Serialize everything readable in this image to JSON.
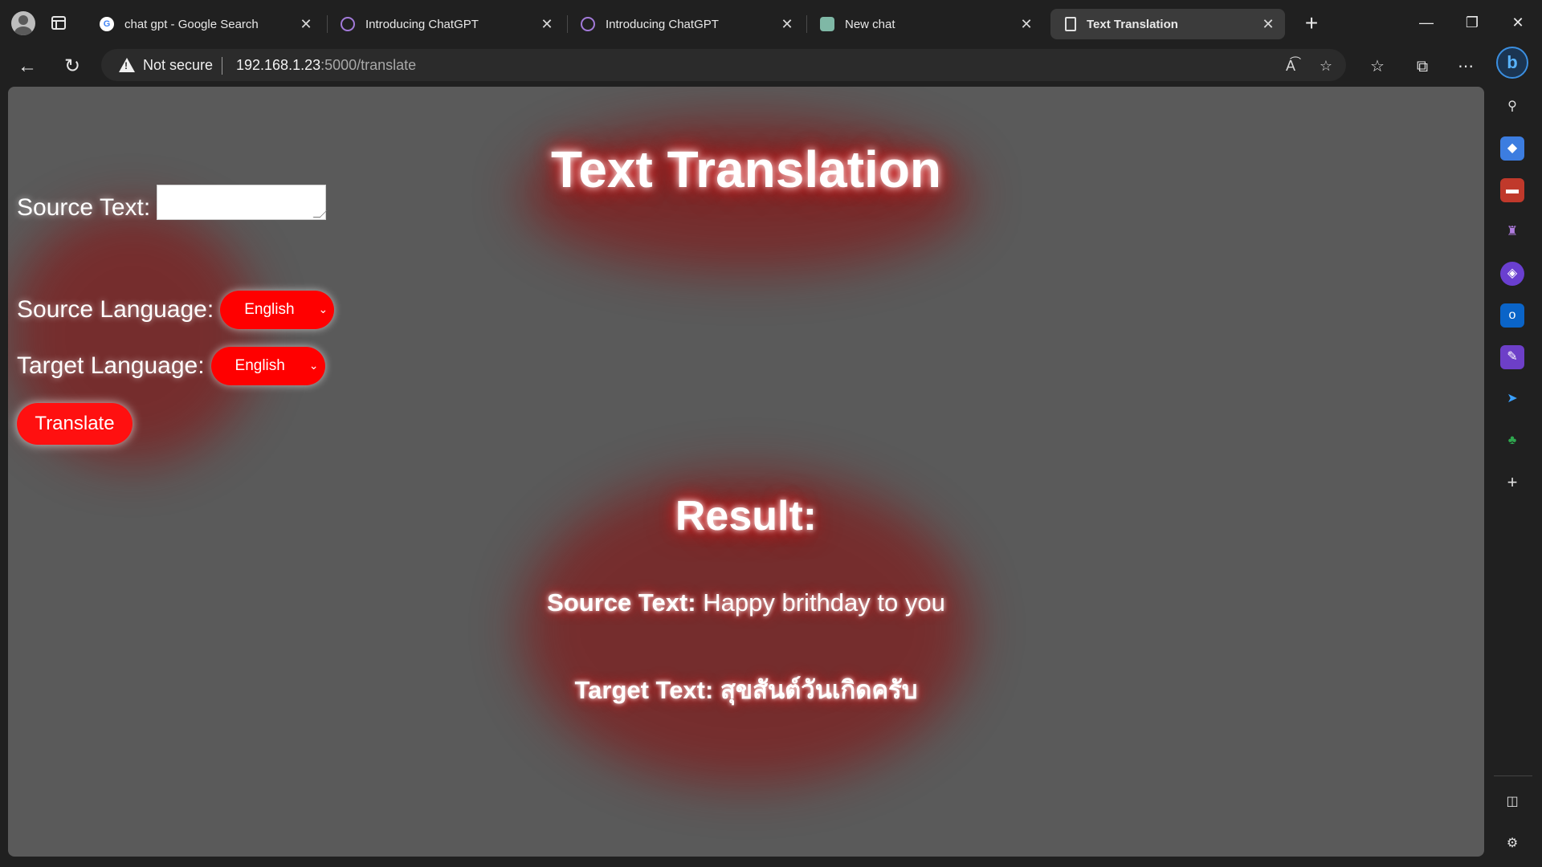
{
  "browser": {
    "tabs": [
      {
        "title": "chat gpt - Google Search",
        "icon": "google-icon",
        "active": false
      },
      {
        "title": "Introducing ChatGPT",
        "icon": "openai-icon",
        "active": false
      },
      {
        "title": "Introducing ChatGPT",
        "icon": "openai-icon",
        "active": false
      },
      {
        "title": "New chat",
        "icon": "chatgpt-icon",
        "active": false
      },
      {
        "title": "Text Translation",
        "icon": "page-icon",
        "active": true
      }
    ],
    "security_label": "Not secure",
    "url_host": "192.168.1.23",
    "url_path": ":5000/translate"
  },
  "page": {
    "title": "Text Translation",
    "form": {
      "source_text_label": "Source Text:",
      "source_text_value": "",
      "source_language_label": "Source Language:",
      "source_language_value": "English",
      "target_language_label": "Target Language:",
      "target_language_value": "English",
      "translate_button": "Translate"
    },
    "result": {
      "heading": "Result:",
      "source_label": "Source Text:",
      "source_value": "Happy brithday to you",
      "target_label": "Target Text:",
      "target_value": "สุขสันต์วันเกิดครับ"
    }
  },
  "colors": {
    "accent_red": "#ff0000",
    "page_background": "#5a5a5a",
    "glow": "#c00000"
  }
}
